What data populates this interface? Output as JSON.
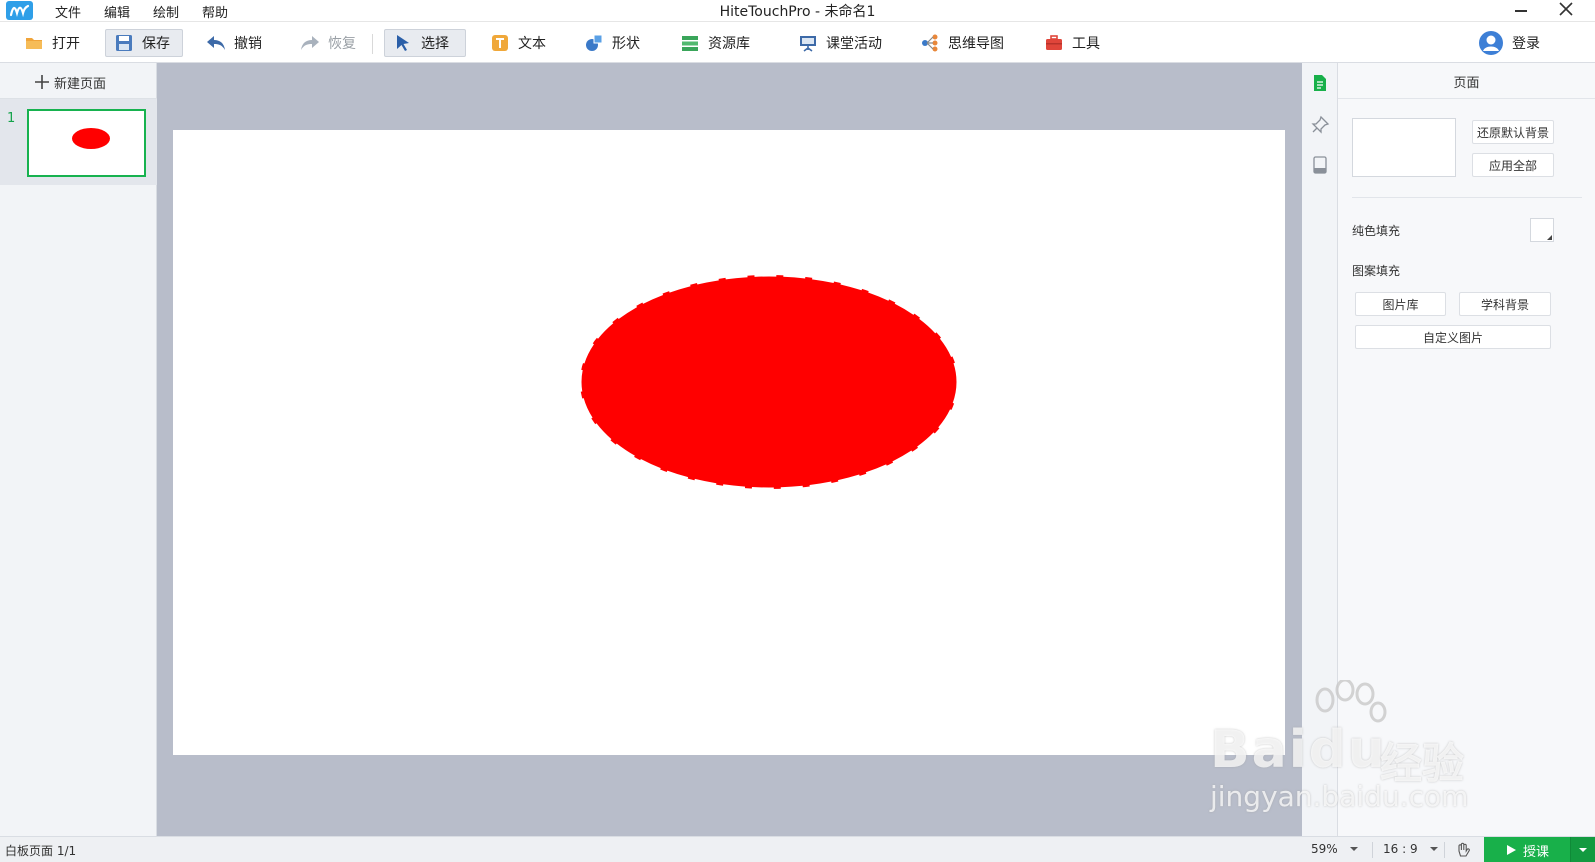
{
  "window": {
    "title": "HiteTouchPro - 未命名1",
    "menu": [
      "文件",
      "编辑",
      "绘制",
      "帮助"
    ]
  },
  "toolbar": {
    "open": "打开",
    "save": "保存",
    "undo": "撤销",
    "redo": "恢复",
    "select": "选择",
    "text": "文本",
    "shape": "形状",
    "resources": "资源库",
    "class_activity": "课堂活动",
    "mind_map": "思维导图",
    "tools": "工具",
    "login": "登录"
  },
  "pages_panel": {
    "new_page": "新建页面",
    "pages": [
      {
        "number": "1"
      }
    ]
  },
  "canvas": {
    "shape": {
      "type": "ellipse",
      "fill": "#ff0000",
      "stroke_style": "dashed"
    }
  },
  "properties": {
    "title": "页面",
    "restore_default_bg": "还原默认背景",
    "apply_all": "应用全部",
    "solid_fill": "纯色填充",
    "pattern_fill": "图案填充",
    "image_library": "图片库",
    "subject_bg": "学科背景",
    "custom_image": "自定义图片"
  },
  "status": {
    "page_info": "白板页面 1/1",
    "zoom": "59%",
    "ratio": "16 : 9",
    "teach": "授课"
  },
  "colors": {
    "accent_green": "#18b04a",
    "canvas_bg": "#b8bdca",
    "shape_fill": "#ff0000"
  },
  "watermark": {
    "brand": "Bai",
    "brand_tail": "du",
    "cn": "经验",
    "url": "jingyan.baidu.com"
  }
}
